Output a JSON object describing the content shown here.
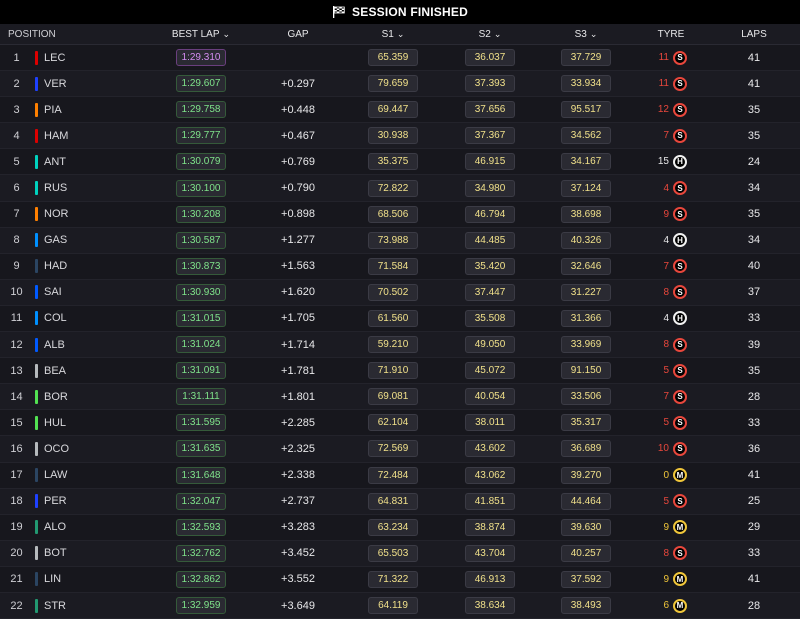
{
  "topbar": {
    "title": "SESSION FINISHED",
    "icon": "chequered-flag-icon"
  },
  "columns": {
    "position": "POSITION",
    "best_lap": "BEST LAP",
    "gap": "GAP",
    "s1": "S1",
    "s2": "S2",
    "s3": "S3",
    "tyre": "TYRE",
    "laps": "LAPS",
    "dropdown_glyph": "⌄"
  },
  "colors": {
    "fastest_lap": "#d38cf0",
    "personal_best": "#7fe38a",
    "sector_time": "#f0e08a",
    "soft": "#e8473c",
    "medium": "#f0c63a",
    "hard": "#f2f2f2"
  },
  "rows": [
    {
      "pos": "1",
      "driver": "LEC",
      "team_color": "#dc0000",
      "best": "1:29.310",
      "best_type": "fast",
      "gap": "",
      "s1": "65.359",
      "s2": "36.037",
      "s3": "37.729",
      "tyre_age": "11",
      "tyre": "S",
      "laps": "41"
    },
    {
      "pos": "2",
      "driver": "VER",
      "team_color": "#1e41ff",
      "best": "1:29.607",
      "best_type": "best",
      "gap": "+0.297",
      "s1": "79.659",
      "s2": "37.393",
      "s3": "33.934",
      "tyre_age": "11",
      "tyre": "S",
      "laps": "41"
    },
    {
      "pos": "3",
      "driver": "PIA",
      "team_color": "#ff8000",
      "best": "1:29.758",
      "best_type": "best",
      "gap": "+0.448",
      "s1": "69.447",
      "s2": "37.656",
      "s3": "95.517",
      "tyre_age": "12",
      "tyre": "S",
      "laps": "35"
    },
    {
      "pos": "4",
      "driver": "HAM",
      "team_color": "#dc0000",
      "best": "1:29.777",
      "best_type": "best",
      "gap": "+0.467",
      "s1": "30.938",
      "s2": "37.367",
      "s3": "34.562",
      "tyre_age": "7",
      "tyre": "S",
      "laps": "35"
    },
    {
      "pos": "5",
      "driver": "ANT",
      "team_color": "#00d2be",
      "best": "1:30.079",
      "best_type": "best",
      "gap": "+0.769",
      "s1": "35.375",
      "s2": "46.915",
      "s3": "34.167",
      "tyre_age": "15",
      "tyre": "H",
      "laps": "24"
    },
    {
      "pos": "6",
      "driver": "RUS",
      "team_color": "#00d2be",
      "best": "1:30.100",
      "best_type": "best",
      "gap": "+0.790",
      "s1": "72.822",
      "s2": "34.980",
      "s3": "37.124",
      "tyre_age": "4",
      "tyre": "S",
      "laps": "34"
    },
    {
      "pos": "7",
      "driver": "NOR",
      "team_color": "#ff8000",
      "best": "1:30.208",
      "best_type": "best",
      "gap": "+0.898",
      "s1": "68.506",
      "s2": "46.794",
      "s3": "38.698",
      "tyre_age": "9",
      "tyre": "S",
      "laps": "35"
    },
    {
      "pos": "8",
      "driver": "GAS",
      "team_color": "#0090ff",
      "best": "1:30.587",
      "best_type": "best",
      "gap": "+1.277",
      "s1": "73.988",
      "s2": "44.485",
      "s3": "40.326",
      "tyre_age": "4",
      "tyre": "H",
      "laps": "34"
    },
    {
      "pos": "9",
      "driver": "HAD",
      "team_color": "#2b4562",
      "best": "1:30.873",
      "best_type": "best",
      "gap": "+1.563",
      "s1": "71.584",
      "s2": "35.420",
      "s3": "32.646",
      "tyre_age": "7",
      "tyre": "S",
      "laps": "40"
    },
    {
      "pos": "10",
      "driver": "SAI",
      "team_color": "#005aff",
      "best": "1:30.930",
      "best_type": "best",
      "gap": "+1.620",
      "s1": "70.502",
      "s2": "37.447",
      "s3": "31.227",
      "tyre_age": "8",
      "tyre": "S",
      "laps": "37"
    },
    {
      "pos": "11",
      "driver": "COL",
      "team_color": "#0090ff",
      "best": "1:31.015",
      "best_type": "best",
      "gap": "+1.705",
      "s1": "61.560",
      "s2": "35.508",
      "s3": "31.366",
      "tyre_age": "4",
      "tyre": "H",
      "laps": "33"
    },
    {
      "pos": "12",
      "driver": "ALB",
      "team_color": "#005aff",
      "best": "1:31.024",
      "best_type": "best",
      "gap": "+1.714",
      "s1": "59.210",
      "s2": "49.050",
      "s3": "33.969",
      "tyre_age": "8",
      "tyre": "S",
      "laps": "39"
    },
    {
      "pos": "13",
      "driver": "BEA",
      "team_color": "#b6babd",
      "best": "1:31.091",
      "best_type": "best",
      "gap": "+1.781",
      "s1": "71.910",
      "s2": "45.072",
      "s3": "91.150",
      "tyre_age": "5",
      "tyre": "S",
      "laps": "35"
    },
    {
      "pos": "14",
      "driver": "BOR",
      "team_color": "#52e252",
      "best": "1:31.111",
      "best_type": "best",
      "gap": "+1.801",
      "s1": "69.081",
      "s2": "40.054",
      "s3": "33.506",
      "tyre_age": "7",
      "tyre": "S",
      "laps": "28"
    },
    {
      "pos": "15",
      "driver": "HUL",
      "team_color": "#52e252",
      "best": "1:31.595",
      "best_type": "best",
      "gap": "+2.285",
      "s1": "62.104",
      "s2": "38.011",
      "s3": "35.317",
      "tyre_age": "5",
      "tyre": "S",
      "laps": "33"
    },
    {
      "pos": "16",
      "driver": "OCO",
      "team_color": "#b6babd",
      "best": "1:31.635",
      "best_type": "best",
      "gap": "+2.325",
      "s1": "72.569",
      "s2": "43.602",
      "s3": "36.689",
      "tyre_age": "10",
      "tyre": "S",
      "laps": "36"
    },
    {
      "pos": "17",
      "driver": "LAW",
      "team_color": "#2b4562",
      "best": "1:31.648",
      "best_type": "best",
      "gap": "+2.338",
      "s1": "72.484",
      "s2": "43.062",
      "s3": "39.270",
      "tyre_age": "0",
      "tyre": "M",
      "laps": "41"
    },
    {
      "pos": "18",
      "driver": "PER",
      "team_color": "#1e41ff",
      "best": "1:32.047",
      "best_type": "best",
      "gap": "+2.737",
      "s1": "64.831",
      "s2": "41.851",
      "s3": "44.464",
      "tyre_age": "5",
      "tyre": "S",
      "laps": "25"
    },
    {
      "pos": "19",
      "driver": "ALO",
      "team_color": "#229971",
      "best": "1:32.593",
      "best_type": "best",
      "gap": "+3.283",
      "s1": "63.234",
      "s2": "38.874",
      "s3": "39.630",
      "tyre_age": "9",
      "tyre": "M",
      "laps": "29"
    },
    {
      "pos": "20",
      "driver": "BOT",
      "team_color": "#b6babd",
      "best": "1:32.762",
      "best_type": "best",
      "gap": "+3.452",
      "s1": "65.503",
      "s2": "43.704",
      "s3": "40.257",
      "tyre_age": "8",
      "tyre": "S",
      "laps": "33"
    },
    {
      "pos": "21",
      "driver": "LIN",
      "team_color": "#2b4562",
      "best": "1:32.862",
      "best_type": "best",
      "gap": "+3.552",
      "s1": "71.322",
      "s2": "46.913",
      "s3": "37.592",
      "tyre_age": "9",
      "tyre": "M",
      "laps": "41"
    },
    {
      "pos": "22",
      "driver": "STR",
      "team_color": "#229971",
      "best": "1:32.959",
      "best_type": "best",
      "gap": "+3.649",
      "s1": "64.119",
      "s2": "38.634",
      "s3": "38.493",
      "tyre_age": "6",
      "tyre": "M",
      "laps": "28"
    }
  ]
}
